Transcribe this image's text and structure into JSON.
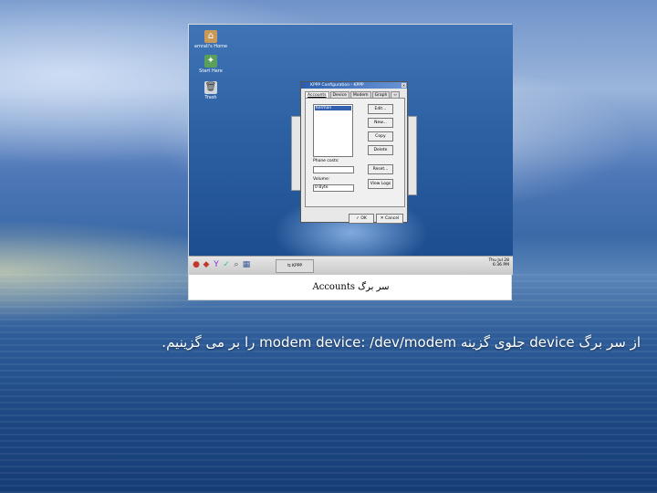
{
  "slide": {
    "body_text": "از سر برگ device جلوی گزینه modem device: /dev/modem را بر می گزینیم."
  },
  "screenshot": {
    "caption": "سر برگ Accounts",
    "desktop_icons": [
      {
        "label": "amrali's Home",
        "icon": "home-icon"
      },
      {
        "label": "Start Here",
        "icon": "start-here-icon"
      },
      {
        "label": "Trash",
        "icon": "trash-icon"
      }
    ],
    "kppp_window": {
      "title": "KPPP Configuration - KPPP",
      "tabs": [
        "Accounts",
        "Device",
        "Modem",
        "Graph"
      ],
      "active_tab": "Accounts",
      "account_selected": "Kerman",
      "buttons": {
        "edit": "Edit...",
        "new": "New...",
        "copy": "Copy",
        "delete": "Delete",
        "reset": "Reset...",
        "view_logs": "View Logs"
      },
      "phone_costs_label": "Phone costs:",
      "volume_label": "Volume:",
      "volume_value": "0 Byte",
      "ok_label": "OK",
      "cancel_label": "Cancel"
    },
    "taskbar": {
      "task_label": "KPPP",
      "clock_date": "Thu Jul 28",
      "clock_time": "6:36 PM"
    }
  }
}
